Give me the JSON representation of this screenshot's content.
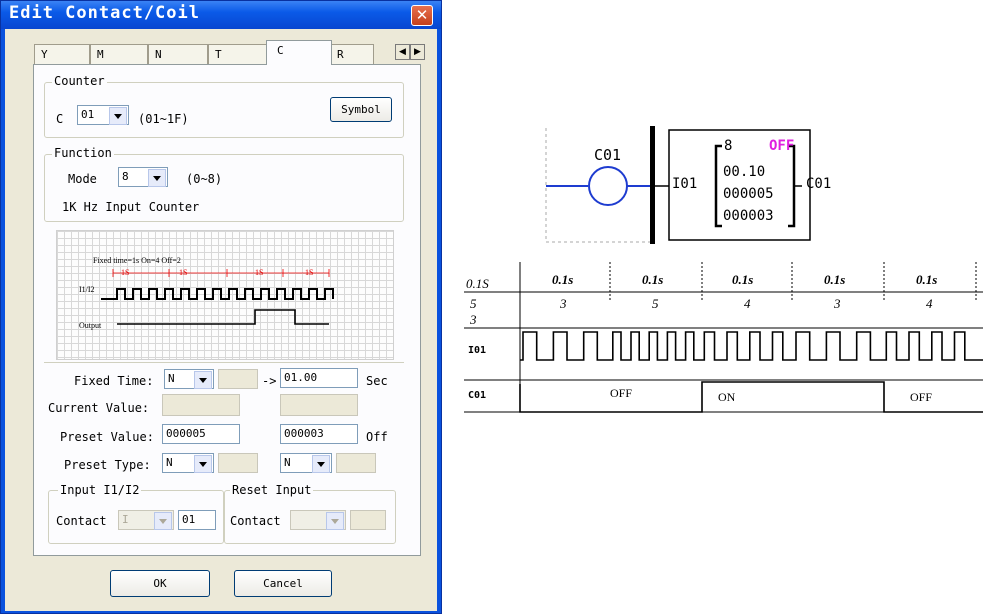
{
  "dialog": {
    "title": "Edit Contact/Coil",
    "tabs": [
      "Y",
      "M",
      "N",
      "T",
      "C",
      "R"
    ],
    "counter": {
      "group_title": "Counter",
      "prefix": "C",
      "number": "01",
      "range": "(01~1F)",
      "symbol_button": "Symbol"
    },
    "function": {
      "group_title": "Function",
      "mode_label": "Mode",
      "mode_value": "8",
      "mode_range": "(0~8)",
      "description": "1K Hz Input Counter"
    },
    "mini_diagram": {
      "caption": "Fixed time=1s On=4 Off=2",
      "marks": [
        "1S",
        "1S",
        "1S",
        "1S"
      ],
      "input_label": "I1/I2",
      "output_label": "Output"
    },
    "fields": {
      "fixed_time_label": "Fixed Time:",
      "fixed_time_type": "N",
      "fixed_time_arrow": "->",
      "fixed_time_value": "01.00",
      "fixed_time_unit": "Sec",
      "current_value_label": "Current Value:",
      "preset_value_label": "Preset Value:",
      "preset_on_value": "000005",
      "preset_off_value": "000003",
      "preset_off_label": "Off",
      "preset_type_label": "Preset Type:",
      "preset_type_on": "N",
      "preset_type_off": "N"
    },
    "input_group": {
      "title": "Input I1/I2",
      "contact_label": "Contact",
      "contact_type": "I",
      "contact_number": "01"
    },
    "reset_group": {
      "title": "Reset Input",
      "contact_label": "Contact"
    },
    "ok_button": "OK",
    "cancel_button": "Cancel"
  },
  "ladder": {
    "coil_label": "C01",
    "input_label": "I01",
    "mode": "8",
    "status": "OFF",
    "time": "00.10",
    "preset_on": "000005",
    "preset_off": "000003",
    "output_label": "C01",
    "status_color": "#e020e0"
  },
  "timing": {
    "header": [
      "0.1S",
      "0.1s",
      "0.1s",
      "0.1s",
      "0.1s",
      "0.1s"
    ],
    "row1_left": "5",
    "row2_left": "3",
    "counts": [
      "3",
      "5",
      "4",
      "3",
      "4"
    ],
    "input_label": "I01",
    "output_label": "C01",
    "output_states": [
      "OFF",
      "ON",
      "OFF"
    ]
  }
}
